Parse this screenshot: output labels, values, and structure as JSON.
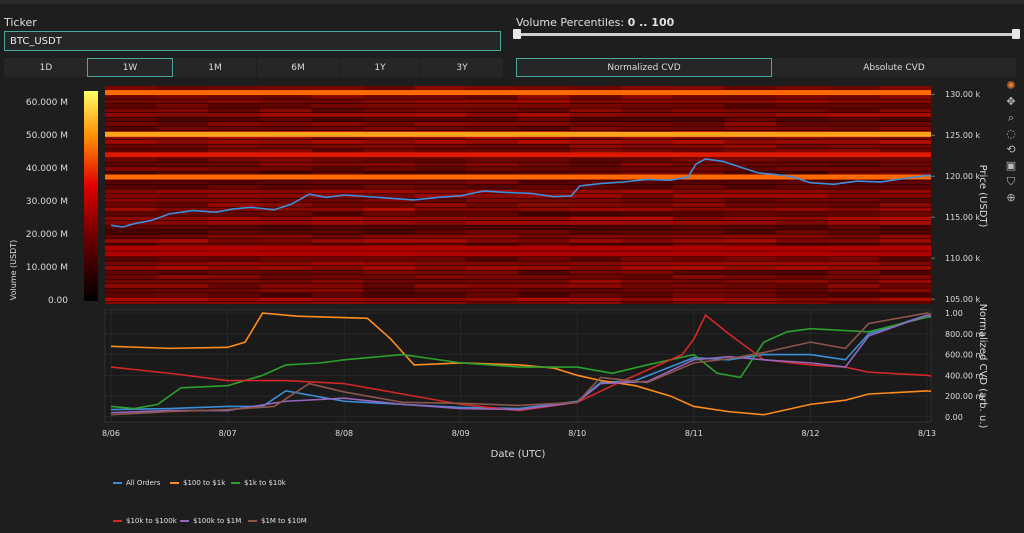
{
  "ticker": {
    "label": "Ticker",
    "value": "BTC_USDT"
  },
  "volume_percentiles": {
    "label": "Volume Percentiles:",
    "range_text": "0 .. 100",
    "min": 0,
    "max": 100
  },
  "time_tabs": [
    "1D",
    "1W",
    "1M",
    "6M",
    "1Y",
    "3Y"
  ],
  "active_time_tab": "1W",
  "cvd_tabs": [
    "Normalized CVD",
    "Absolute CVD"
  ],
  "active_cvd_tab": "Normalized CVD",
  "legend": [
    "All Orders",
    "$100 to $1k",
    "$1k to $10k",
    "$10k to $100k",
    "$100k to $1M",
    "$1M to $10M"
  ],
  "colors": {
    "accent": "#4aa89c",
    "All Orders": "#3b8fd9",
    "$100 to $1k": "#ff8c1a",
    "$1k to $10k": "#2ca02c",
    "$10k to $100k": "#d62728",
    "$100k to $1M": "#9467bd",
    "$1M to $10M": "#8c564b"
  },
  "modebar_icons": [
    "plotly-logo-icon",
    "pan-icon",
    "zoom-icon",
    "lasso-icon",
    "reset-icon",
    "download-icon",
    "hover-icon",
    "spike-icon"
  ],
  "chart_data": [
    {
      "type": "heatmap",
      "colorbar_title": "Volume (USDT)",
      "colorbar_ticks": [
        "0.00",
        "10.000 M",
        "20.000 M",
        "30.000 M",
        "40.000 M",
        "50.000 M",
        "60.000 M"
      ],
      "colorbar_range": [
        0,
        64000000
      ],
      "y2label": "Price (USDT)",
      "y2_ticks": [
        "105.00 k",
        "110.00 k",
        "115.00 k",
        "120.00 k",
        "125.00 k",
        "130.00 k"
      ],
      "y2lim": [
        104400,
        131000
      ],
      "price_series": {
        "name": "Price",
        "x": [
          0,
          0.1,
          0.2,
          0.35,
          0.5,
          0.7,
          0.9,
          1.05,
          1.2,
          1.4,
          1.55,
          1.7,
          1.85,
          2.0,
          2.2,
          2.4,
          2.6,
          2.8,
          3.0,
          3.2,
          3.4,
          3.6,
          3.8,
          3.95,
          4.02,
          4.2,
          4.4,
          4.6,
          4.8,
          4.95,
          5.02,
          5.1,
          5.25,
          5.4,
          5.55,
          5.7,
          5.85,
          6.0,
          6.2,
          6.4,
          6.6,
          6.8,
          7.0,
          7.1
        ],
        "y": [
          114000,
          113800,
          114200,
          114600,
          115400,
          115800,
          115600,
          116000,
          116200,
          115900,
          116600,
          117800,
          117400,
          117700,
          117500,
          117300,
          117100,
          117400,
          117600,
          118200,
          118000,
          117900,
          117500,
          117600,
          118800,
          119100,
          119300,
          119600,
          119500,
          119900,
          121500,
          122100,
          121800,
          121100,
          120400,
          120200,
          119900,
          119200,
          119000,
          119400,
          119300,
          119700,
          120100,
          119800
        ]
      },
      "bands": [
        {
          "price": 130200,
          "volume": 44000000
        },
        {
          "price": 125100,
          "volume": 52000000
        },
        {
          "price": 122600,
          "volume": 23000000
        },
        {
          "price": 119900,
          "volume": 36000000
        },
        {
          "price": 111200,
          "volume": 19000000
        },
        {
          "price": 110500,
          "volume": 16000000
        }
      ]
    },
    {
      "type": "line",
      "xlabel": "Date (UTC)",
      "x_ticks": [
        "8/06",
        "8/07",
        "8/08",
        "8/09",
        "8/10",
        "8/11",
        "8/12",
        "8/13"
      ],
      "y2label": "Normalized CVD (arb. u.)",
      "y2_ticks": [
        "0.00",
        "200.00 m",
        "400.00 m",
        "600.00 m",
        "800.00 m",
        "1.00"
      ],
      "y2lim": [
        -0.05,
        1.03
      ],
      "series": [
        {
          "name": "All Orders",
          "x": [
            0,
            0.5,
            1,
            1.3,
            1.5,
            2,
            2.5,
            3,
            3.5,
            4,
            4.2,
            4.5,
            5,
            5.3,
            5.6,
            6,
            6.3,
            6.5,
            7,
            7.1
          ],
          "y": [
            0.07,
            0.08,
            0.1,
            0.1,
            0.25,
            0.15,
            0.12,
            0.09,
            0.08,
            0.15,
            0.33,
            0.35,
            0.57,
            0.55,
            0.6,
            0.6,
            0.55,
            0.8,
            0.98,
            0.94
          ]
        },
        {
          "name": "$100 to $1k",
          "x": [
            0,
            0.5,
            1,
            1.15,
            1.3,
            1.6,
            2.2,
            2.4,
            2.6,
            3,
            3.5,
            3.8,
            4,
            4.2,
            4.5,
            4.8,
            5,
            5.3,
            5.6,
            6,
            6.3,
            6.5,
            7,
            7.1
          ],
          "y": [
            0.68,
            0.66,
            0.67,
            0.72,
            1.0,
            0.97,
            0.95,
            0.75,
            0.5,
            0.52,
            0.5,
            0.47,
            0.4,
            0.35,
            0.3,
            0.2,
            0.1,
            0.05,
            0.02,
            0.12,
            0.16,
            0.22,
            0.25,
            0.24
          ]
        },
        {
          "name": "$1k to $10k",
          "x": [
            0,
            0.2,
            0.4,
            0.6,
            1,
            1.3,
            1.5,
            1.8,
            2,
            2.3,
            2.5,
            3,
            3.5,
            4,
            4.3,
            4.6,
            5,
            5.2,
            5.4,
            5.6,
            5.8,
            6,
            6.5,
            7,
            7.1
          ],
          "y": [
            0.1,
            0.08,
            0.12,
            0.28,
            0.3,
            0.4,
            0.5,
            0.52,
            0.55,
            0.58,
            0.6,
            0.52,
            0.48,
            0.48,
            0.42,
            0.5,
            0.6,
            0.42,
            0.38,
            0.72,
            0.82,
            0.85,
            0.82,
            0.96,
            0.97
          ]
        },
        {
          "name": "$10k to $100k",
          "x": [
            0,
            0.5,
            1,
            1.5,
            2,
            2.5,
            3,
            3.5,
            4,
            4.3,
            4.6,
            4.9,
            5,
            5.1,
            5.3,
            5.6,
            6,
            6.3,
            6.5,
            7,
            7.1
          ],
          "y": [
            0.48,
            0.42,
            0.35,
            0.35,
            0.32,
            0.22,
            0.12,
            0.06,
            0.14,
            0.3,
            0.45,
            0.6,
            0.75,
            0.98,
            0.8,
            0.55,
            0.5,
            0.48,
            0.43,
            0.4,
            0.38
          ]
        },
        {
          "name": "$100k to $1M",
          "x": [
            0,
            0.5,
            1,
            1.5,
            2,
            2.5,
            3,
            3.5,
            4,
            4.2,
            4.6,
            5,
            5.3,
            5.6,
            6,
            6.3,
            6.5,
            7,
            7.1
          ],
          "y": [
            0.04,
            0.06,
            0.06,
            0.15,
            0.18,
            0.12,
            0.08,
            0.07,
            0.14,
            0.32,
            0.34,
            0.55,
            0.58,
            0.55,
            0.52,
            0.48,
            0.78,
            0.98,
            0.96
          ]
        },
        {
          "name": "$1M to $10M",
          "x": [
            0,
            0.5,
            1,
            1.4,
            1.7,
            2,
            2.5,
            3,
            3.5,
            4,
            4.2,
            4.6,
            5,
            5.3,
            5.6,
            6,
            6.3,
            6.5,
            7,
            7.1
          ],
          "y": [
            0.02,
            0.05,
            0.07,
            0.1,
            0.32,
            0.24,
            0.14,
            0.13,
            0.11,
            0.14,
            0.38,
            0.33,
            0.52,
            0.56,
            0.62,
            0.72,
            0.66,
            0.9,
            1.0,
            0.97
          ]
        }
      ]
    }
  ]
}
